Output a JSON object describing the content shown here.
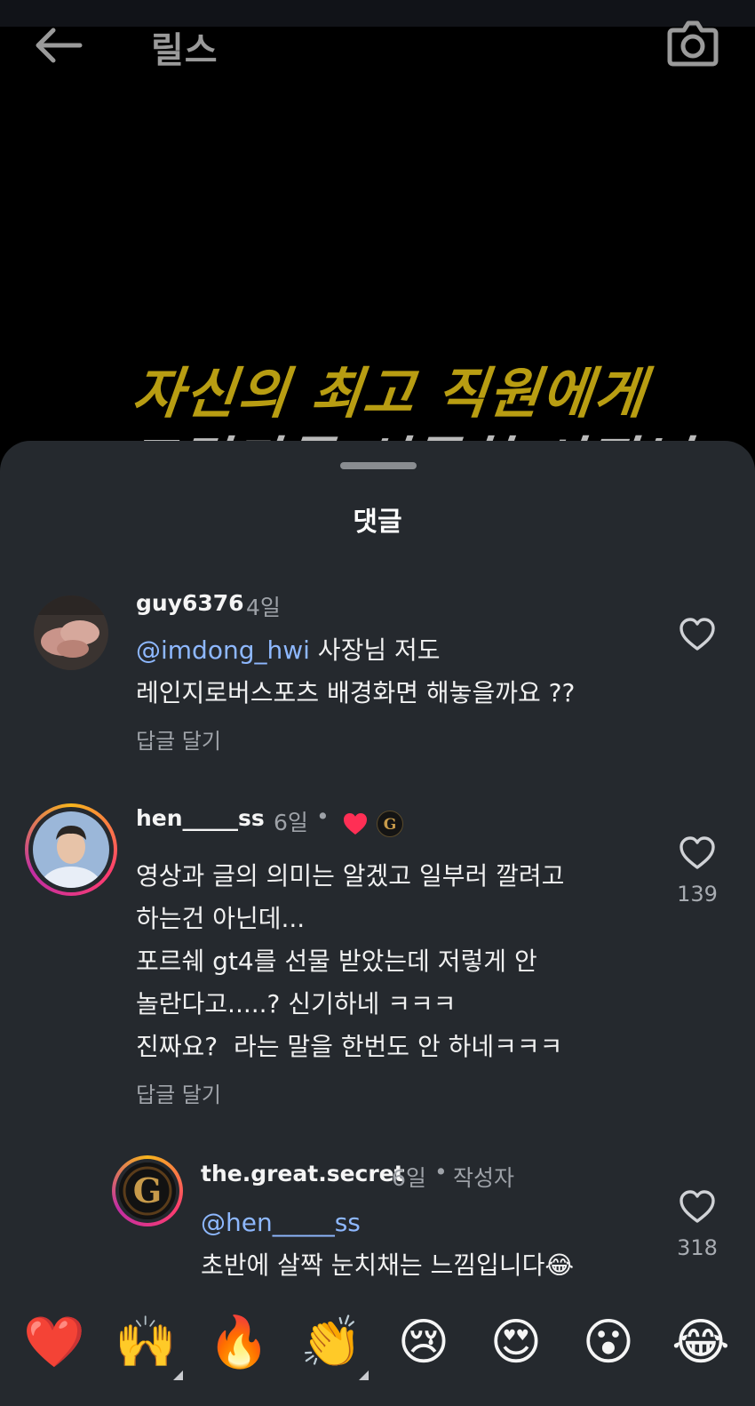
{
  "header": {
    "title": "릴스",
    "back_icon": "arrow-left-icon",
    "camera_icon": "camera-icon"
  },
  "video": {
    "caption_line1": "자신의 최고 직원에게",
    "caption_line2": "드림카를 선물한 사장님"
  },
  "sheet": {
    "title": "댓글"
  },
  "comments": [
    {
      "username": "guy6376",
      "time": "4일",
      "mention": "@imdong_hwi",
      "text_after_mention": " 사장님 저도",
      "lines": [
        "레인지로버스포츠 배경화면 해놓을까요 ??"
      ],
      "reply_label": "답글 달기",
      "like_count": ""
    },
    {
      "username": "hen_____ss",
      "time": "6일",
      "separator": "•",
      "liked_by_author": true,
      "lines": [
        "영상과 글의 의미는 알겠고 일부러 깔려고",
        "하는건 아닌데...",
        "포르쉐 gt4를 선물 받았는데 저렇게 안",
        "놀란다고.....? 신기하네 ㅋㅋㅋ",
        "진짜요?  라는 말을 한번도 안 하네ㅋㅋㅋ"
      ],
      "reply_label": "답글 달기",
      "like_count": "139"
    }
  ],
  "reply": {
    "username": "the.great.secret",
    "time": "6일",
    "separator": "•",
    "author_badge": "작성자",
    "mention": "@hen_____ss",
    "text": "초반에 살짝 눈치채는 느낌입니다😂",
    "like_count": "318"
  },
  "reactions": [
    {
      "emoji": "❤️",
      "name": "red-heart"
    },
    {
      "emoji": "🙌",
      "name": "raising-hands"
    },
    {
      "emoji": "🔥",
      "name": "fire"
    },
    {
      "emoji": "👏",
      "name": "clapping-hands"
    },
    {
      "emoji": "😢",
      "name": "crying-face"
    },
    {
      "emoji": "😍",
      "name": "heart-eyes"
    },
    {
      "emoji": "😮",
      "name": "surprised-face"
    },
    {
      "emoji": "😂",
      "name": "tears-of-joy"
    }
  ],
  "colors": {
    "sheet_bg": "#25292e",
    "mention": "#8eb8ff",
    "caption_yellow": "#b89d12",
    "heart_red": "#ff2f55"
  }
}
